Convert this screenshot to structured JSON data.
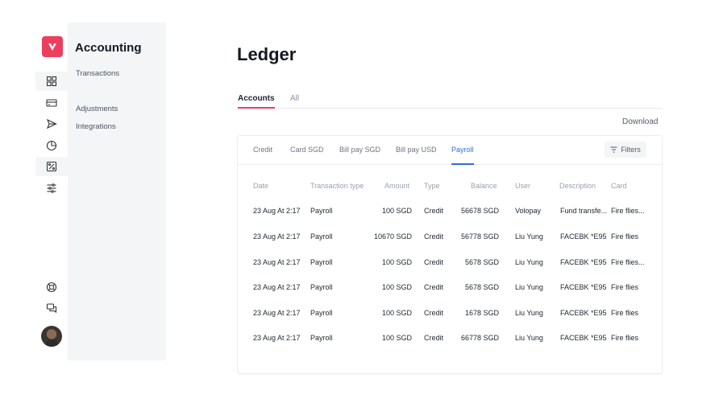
{
  "sidebar": {
    "title": "Accounting",
    "links": [
      "Transactions",
      "Adjustments",
      "Integrations"
    ]
  },
  "rail": {
    "icons": [
      "dashboard-icon",
      "card-icon",
      "send-icon",
      "pie-chart-icon",
      "ledger-icon",
      "sliders-icon"
    ],
    "bottom_icons": [
      "help-icon",
      "chat-icon"
    ]
  },
  "page": {
    "title": "Ledger",
    "tabs": [
      "Accounts",
      "All"
    ],
    "download_label": "Download"
  },
  "ledger": {
    "sub_tabs": [
      "Credit",
      "Card SGD",
      "Bill pay SGD",
      "Bill pay USD",
      "Payroll"
    ],
    "filters_label": "Filters",
    "columns": [
      "Date",
      "Transaction type",
      "Amount",
      "Type",
      "Balance",
      "User",
      "Description",
      "Card"
    ],
    "rows": [
      [
        "23 Aug At 2:17",
        "Payroll",
        "100 SGD",
        "Credit",
        "56678 SGD",
        "Volopay",
        "Fund transfe...",
        "Fire flies..."
      ],
      [
        "23 Aug At 2:17",
        "Payroll",
        "10670 SGD",
        "Credit",
        "56778 SGD",
        "Liu Yung",
        "FACEBK *E95",
        "Fire flies"
      ],
      [
        "23 Aug At 2:17",
        "Payroll",
        "100 SGD",
        "Credit",
        "5678 SGD",
        "Liu Yung",
        "FACEBK *E95",
        "Fire flies..."
      ],
      [
        "23 Aug At 2:17",
        "Payroll",
        "100 SGD",
        "Credit",
        "5678 SGD",
        "Liu Yung",
        "FACEBK *E95",
        "Fire flies"
      ],
      [
        "23 Aug At 2:17",
        "Payroll",
        "100 SGD",
        "Credit",
        "1678 SGD",
        "Liu Yung",
        "FACEBK *E95",
        "Fire flies"
      ],
      [
        "23 Aug At 2:17",
        "Payroll",
        "100 SGD",
        "Credit",
        "66778 SGD",
        "Liu Yung",
        "FACEBK *E95",
        "Fire flies"
      ]
    ]
  },
  "colors": {
    "brand": "#ec3e5e",
    "accent": "#2f6fd6",
    "panel": "#f4f5f7"
  }
}
